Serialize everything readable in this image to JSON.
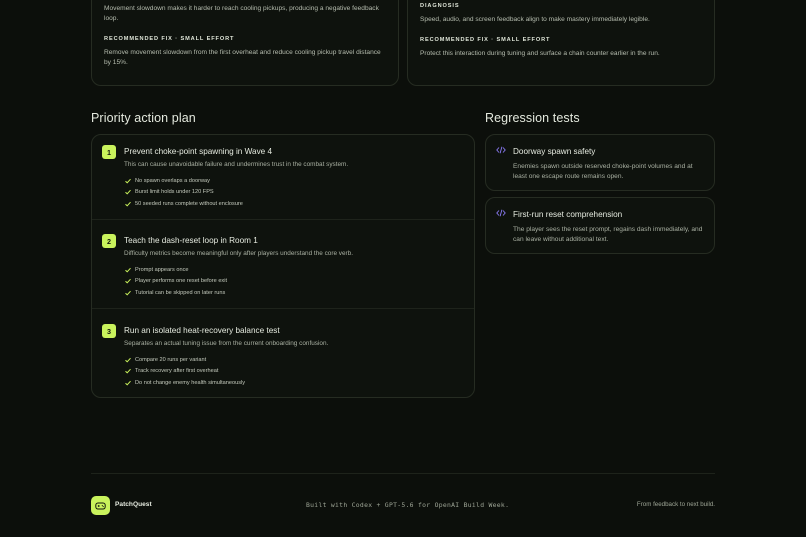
{
  "top_cards": {
    "left": {
      "body": "Movement slowdown makes it harder to reach cooling pickups, producing a negative feedback loop.",
      "fix_kicker": "RECOMMENDED FIX · SMALL EFFORT",
      "fix_text": "Remove movement slowdown from the first overheat and reduce cooling pickup travel distance by 15%."
    },
    "right": {
      "diag_kicker": "DIAGNOSIS",
      "body": "Speed, audio, and screen feedback align to make mastery immediately legible.",
      "fix_kicker": "RECOMMENDED FIX · SMALL EFFORT",
      "fix_text": "Protect this interaction during tuning and surface a chain counter earlier in the run."
    }
  },
  "priority": {
    "title": "Priority action plan",
    "items": [
      {
        "number": "1",
        "title": "Prevent choke-point spawning in Wave 4",
        "desc": "This can cause unavoidable failure and undermines trust in the combat system.",
        "checks": [
          "No spawn overlaps a doorway",
          "Burst limit holds under 120 FPS",
          "50 seeded runs complete without enclosure"
        ]
      },
      {
        "number": "2",
        "title": "Teach the dash-reset loop in Room 1",
        "desc": "Difficulty metrics become meaningful only after players understand the core verb.",
        "checks": [
          "Prompt appears once",
          "Player performs one reset before exit",
          "Tutorial can be skipped on later runs"
        ]
      },
      {
        "number": "3",
        "title": "Run an isolated heat-recovery balance test",
        "desc": "Separates an actual tuning issue from the current onboarding confusion.",
        "checks": [
          "Compare 20 runs per variant",
          "Track recovery after first overheat",
          "Do not change enemy health simultaneously"
        ]
      }
    ]
  },
  "regression": {
    "title": "Regression tests",
    "items": [
      {
        "title": "Doorway spawn safety",
        "desc": "Enemies spawn outside reserved choke-point volumes and at least one escape route remains open."
      },
      {
        "title": "First-run reset comprehension",
        "desc": "The player sees the reset prompt, regains dash immediately, and can leave without additional text."
      }
    ]
  },
  "footer": {
    "brand": "PatchQuest",
    "built_with": "Built with Codex + GPT-5.6 for OpenAI Build Week.",
    "tagline": "From feedback to next build."
  },
  "colors": {
    "accent": "#c9f25c",
    "code_icon": "#8b7cf6",
    "background": "#0c0f0b"
  }
}
